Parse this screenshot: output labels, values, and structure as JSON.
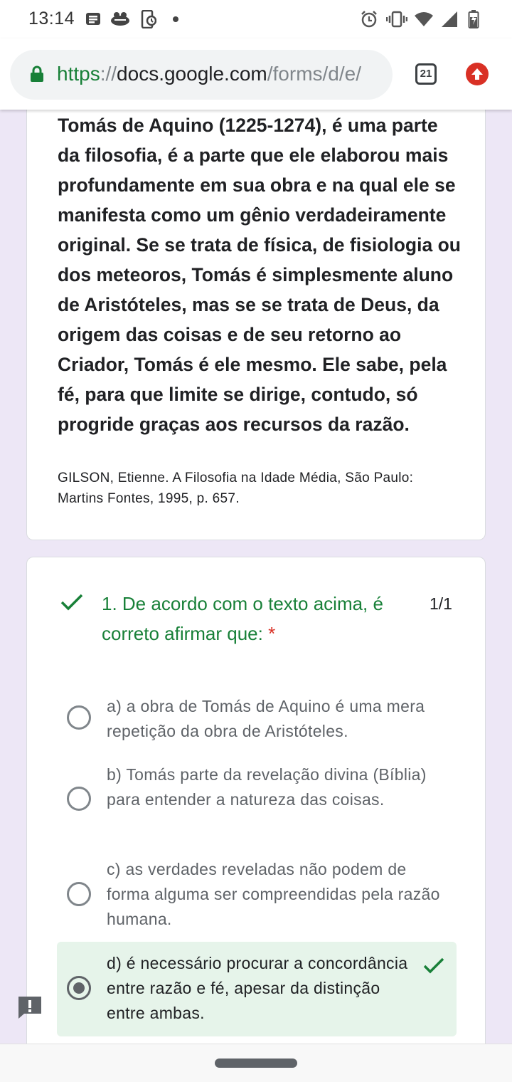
{
  "status_bar": {
    "time": "13:14",
    "left_icons": [
      "news-icon",
      "mail-icon",
      "phone-sync-icon",
      "dot-icon"
    ],
    "right_icons": [
      "alarm-icon",
      "vibrate-icon",
      "wifi-icon",
      "signal-icon",
      "battery-icon"
    ]
  },
  "browser": {
    "url_scheme": "https",
    "url_sep": "://",
    "url_host": "docs.google.com",
    "url_path": "/forms/d/e/",
    "tab_count": "21",
    "accent_color": "#188038",
    "update_color": "#d93025"
  },
  "passage": {
    "text": "Tomás de Aquino (1225-1274), é uma parte da filosofia, é a parte que ele elaborou mais profundamente em sua obra e na qual ele se manifesta como um gênio verdadeiramente original. Se se trata de física, de fisiologia ou dos meteoros, Tomás é simplesmente aluno de Aristóteles, mas se se trata de Deus, da origem das coisas e de seu retorno ao Criador, Tomás é ele mesmo. Ele sabe, pela fé, para que limite se dirige, contudo, só progride graças aos recursos da razão.",
    "citation": "GILSON, Etienne. A Filosofia na Idade Média, São Paulo: Martins Fontes, 1995, p. 657."
  },
  "question": {
    "title": "1. De acordo com o texto acima, é correto afirmar que:",
    "required_mark": "*",
    "score": "1/1",
    "options": [
      {
        "label": "a) a obra de Tomás de Aquino é uma mera repetição da obra de Aristóteles.",
        "selected": false
      },
      {
        "label": "b) Tomás parte da revelação divina (Bíblia) para entender a natureza das coisas.",
        "selected": false
      },
      {
        "label": "c) as verdades reveladas não podem de forma alguma ser compreendidas pela razão humana.",
        "selected": false
      },
      {
        "label": "d) é necessário procurar a concordância entre razão e fé, apesar da distinção entre ambas.",
        "selected": true,
        "correct": true
      }
    ],
    "correct_color": "#188038",
    "correct_bg": "#e6f4ea"
  }
}
